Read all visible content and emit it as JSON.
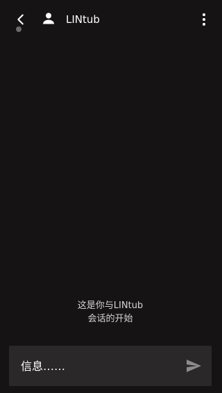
{
  "header": {
    "contact_name": "LINtub",
    "back_icon": "chevron-left-icon",
    "avatar_icon": "person-icon",
    "more_icon": "vertical-ellipsis-icon",
    "status_color": "#6a6a6a"
  },
  "conversation": {
    "empty_line_1": "这是你与LINtub",
    "empty_line_2": "会话的开始"
  },
  "composer": {
    "placeholder": "信息……",
    "value": "",
    "send_icon": "send-icon"
  },
  "colors": {
    "background": "#151314",
    "composer_background": "#2a2829",
    "text": "#ffffff",
    "muted_icon": "#8c8c8c"
  }
}
